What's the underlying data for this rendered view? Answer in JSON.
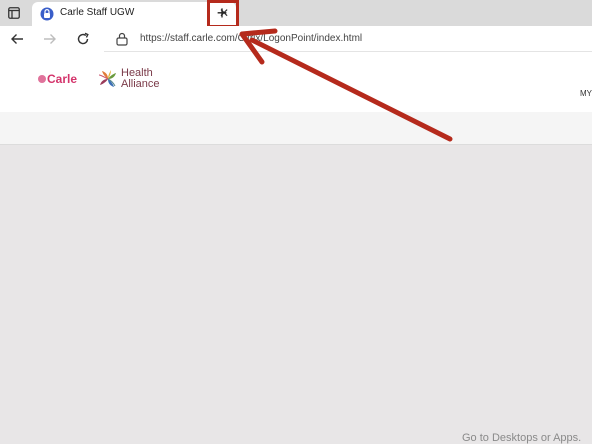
{
  "browser": {
    "tab": {
      "title": "Carle Staff UGW",
      "close_glyph": "✕"
    },
    "new_tab_glyph": "+",
    "address": {
      "url": "https://staff.carle.com/Citrix/LogonPoint/index.html"
    }
  },
  "site": {
    "carle_logo": "Carle",
    "health_alliance_line1": "Health",
    "health_alliance_line2": "Alliance",
    "my_label": "MY"
  },
  "footer": {
    "text": "Go to Desktops or Apps."
  },
  "colors": {
    "annotation_red": "#b52a1c",
    "carle_pink": "#d4346b",
    "health_alliance": "#7a3a48"
  },
  "icons": {
    "tab_actions": "tab-actions-icon",
    "favicon": "lock-shield-favicon-icon",
    "back": "back-arrow-icon",
    "forward": "forward-arrow-icon",
    "reload": "reload-icon",
    "lock": "lock-icon"
  }
}
